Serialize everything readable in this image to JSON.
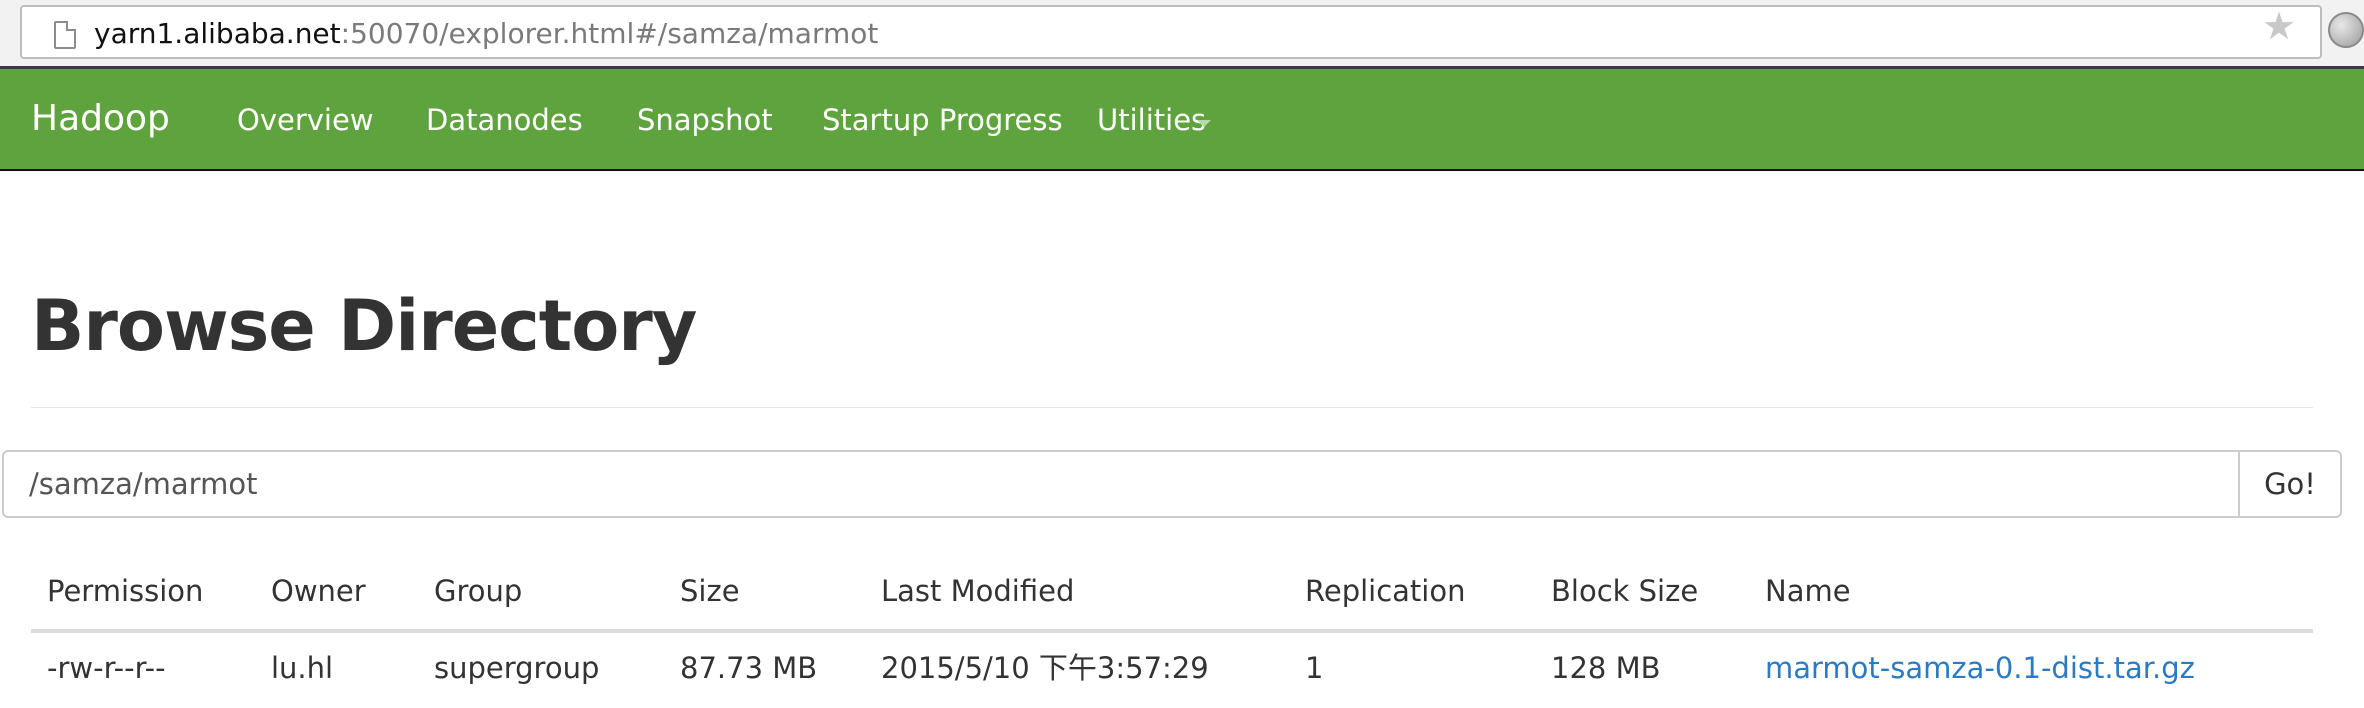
{
  "browser": {
    "url_host": "yarn1.alibaba.net",
    "url_path": ":50070/explorer.html#/samza/marmot",
    "icons": [
      "page-icon",
      "star-icon",
      "globe-icon"
    ]
  },
  "navbar": {
    "brand": "Hadoop",
    "items": [
      {
        "label": "Overview"
      },
      {
        "label": "Datanodes"
      },
      {
        "label": "Snapshot"
      },
      {
        "label": "Startup Progress"
      },
      {
        "label": "Utilities"
      }
    ],
    "background_color": "#5fa33e"
  },
  "page": {
    "title": "Browse Directory"
  },
  "directory": {
    "path_value": "/samza/marmot",
    "go_label": "Go!"
  },
  "table": {
    "columns": [
      "Permission",
      "Owner",
      "Group",
      "Size",
      "Last Modified",
      "Replication",
      "Block Size",
      "Name"
    ],
    "rows": [
      {
        "permission": "-rw-r--r--",
        "owner": "lu.hl",
        "group": "supergroup",
        "size": "87.73 MB",
        "last_modified": "2015/5/10 下午3:57:29",
        "replication": "1",
        "block_size": "128 MB",
        "name": "marmot-samza-0.1-dist.tar.gz"
      }
    ],
    "link_color": "#2a7bc4"
  }
}
